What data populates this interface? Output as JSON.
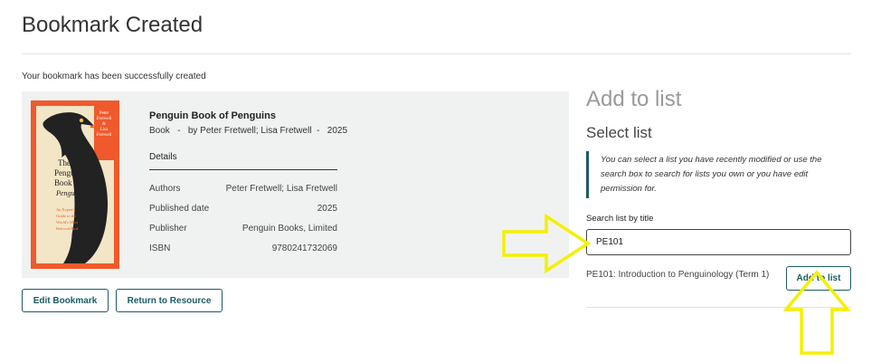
{
  "page": {
    "title": "Bookmark Created",
    "success_message": "Your bookmark has been successfully created"
  },
  "resource": {
    "title": "Penguin Book of Penguins",
    "type": "Book",
    "sep1": "-",
    "by_text": "by Peter Fretwell; Lisa Fretwell",
    "sep2": "-",
    "year": "2025",
    "details_heading": "Details",
    "details": [
      {
        "label": "Authors",
        "value": "Peter Fretwell; Lisa Fretwell"
      },
      {
        "label": "Published date",
        "value": "2025"
      },
      {
        "label": "Publisher",
        "value": "Penguin Books, Limited"
      },
      {
        "label": "ISBN",
        "value": "9780241732069"
      }
    ],
    "cover": {
      "title_line1": "The",
      "title_line2": "Penguin",
      "title_line3": "Book of",
      "title_line4": "Penguins",
      "author_line1": "Peter",
      "author_line2": "Fretwell",
      "author_line3": "&",
      "author_line4": "Lisa",
      "author_line5": "Fretwell",
      "subtitle_line1": "An Expert's",
      "subtitle_line2": "Guide to the",
      "subtitle_line3": "World's Most",
      "subtitle_line4": "Beloved Bird",
      "colors": {
        "background": "#f0592b",
        "panel": "#f3e6c6",
        "bird": "#222222"
      }
    }
  },
  "actions": {
    "edit_bookmark": "Edit Bookmark",
    "return_to_resource": "Return to Resource"
  },
  "add_to_list": {
    "heading": "Add to list",
    "select_heading": "Select list",
    "note": "You can select a list you have recently modified or use the search box to search for lists you own or you have edit permission for.",
    "search_label": "Search list by title",
    "search_value": "PE101",
    "result_label": "PE101: Introduction to Penguinology (Term 1)",
    "add_button": "Add to list"
  },
  "theme": {
    "accent": "#1c5b66",
    "annotation_arrow": "#f4f000"
  }
}
